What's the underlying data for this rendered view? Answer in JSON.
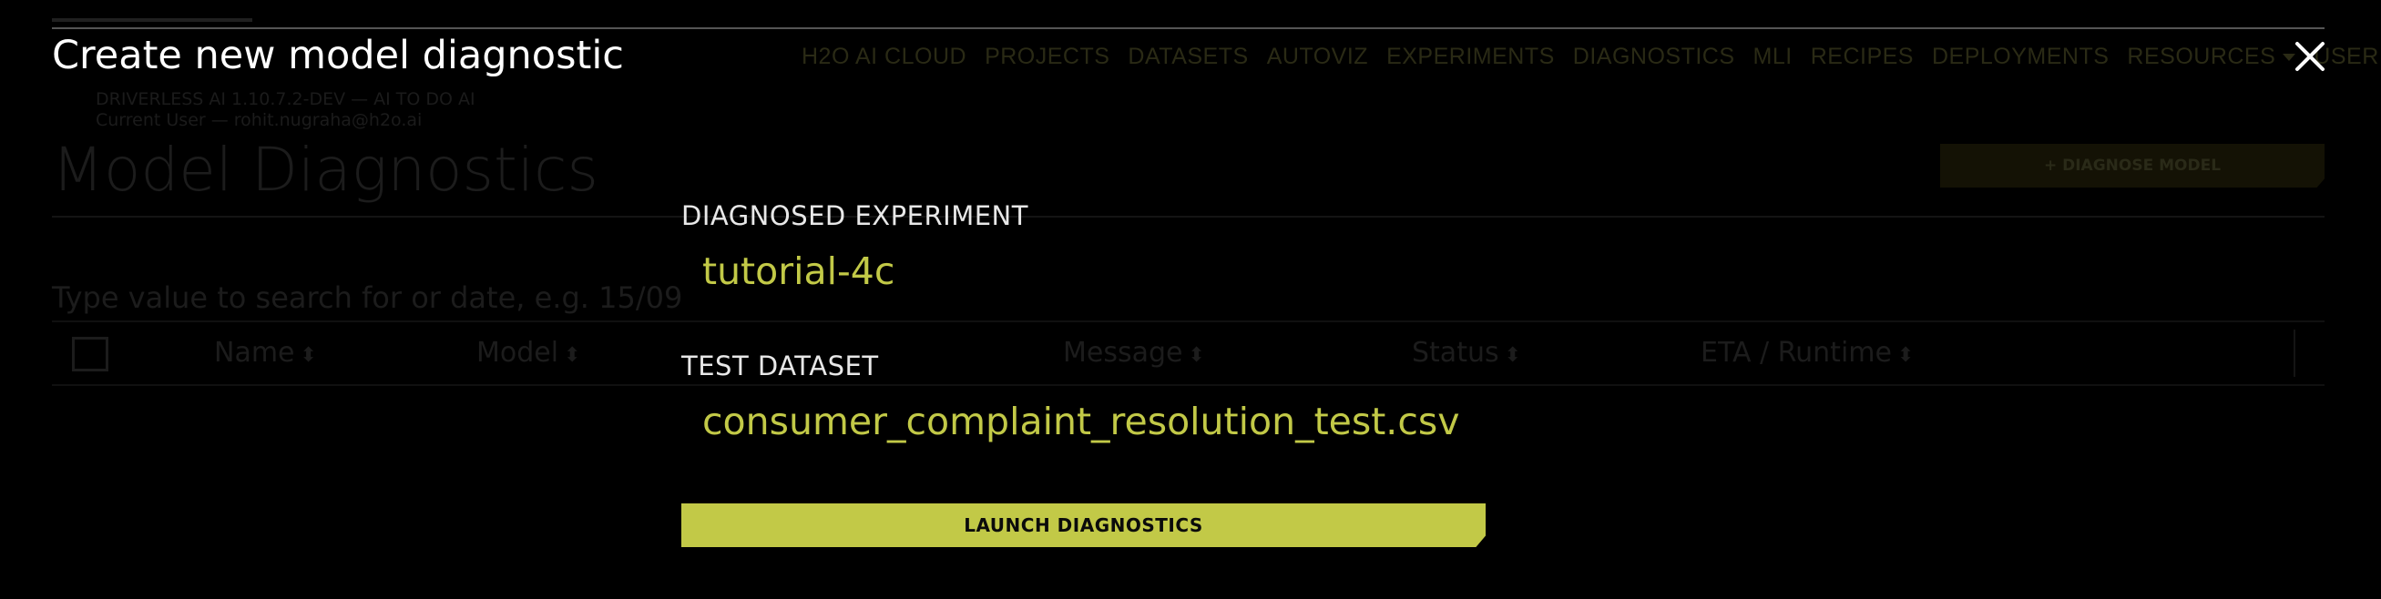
{
  "background": {
    "version_line1": "DRIVERLESS AI 1.10.7.2-DEV — AI TO DO AI",
    "version_line2": "Current User — rohit.nugraha@h2o.ai",
    "page_title": "Model Diagnostics",
    "diagnose_button": "+ DIAGNOSE MODEL",
    "search_placeholder": "Type value to search for or date, e.g. 15/09",
    "columns": [
      "Name",
      "Model",
      "Message",
      "Status",
      "ETA / Runtime"
    ]
  },
  "modal": {
    "title": "Create new model diagnostic",
    "nav": [
      {
        "label": "H2O AI CLOUD",
        "dropdown": false
      },
      {
        "label": "PROJECTS",
        "dropdown": false
      },
      {
        "label": "DATASETS",
        "dropdown": false
      },
      {
        "label": "AUTOVIZ",
        "dropdown": false
      },
      {
        "label": "EXPERIMENTS",
        "dropdown": false
      },
      {
        "label": "DIAGNOSTICS",
        "dropdown": false
      },
      {
        "label": "MLI",
        "dropdown": false
      },
      {
        "label": "RECIPES",
        "dropdown": false
      },
      {
        "label": "DEPLOYMENTS",
        "dropdown": false
      },
      {
        "label": "RESOURCES",
        "dropdown": true
      },
      {
        "label": "USER",
        "dropdown": true
      }
    ],
    "close_icon": "close-icon",
    "fields": {
      "experiment_label": "DIAGNOSED EXPERIMENT",
      "experiment_value": "tutorial-4c",
      "dataset_label": "TEST DATASET",
      "dataset_value": "consumer_complaint_resolution_test.csv"
    },
    "launch_button": "LAUNCH DIAGNOSTICS"
  },
  "colors": {
    "accent": "#c2c947",
    "background": "#000000",
    "title": "#ffffff"
  }
}
